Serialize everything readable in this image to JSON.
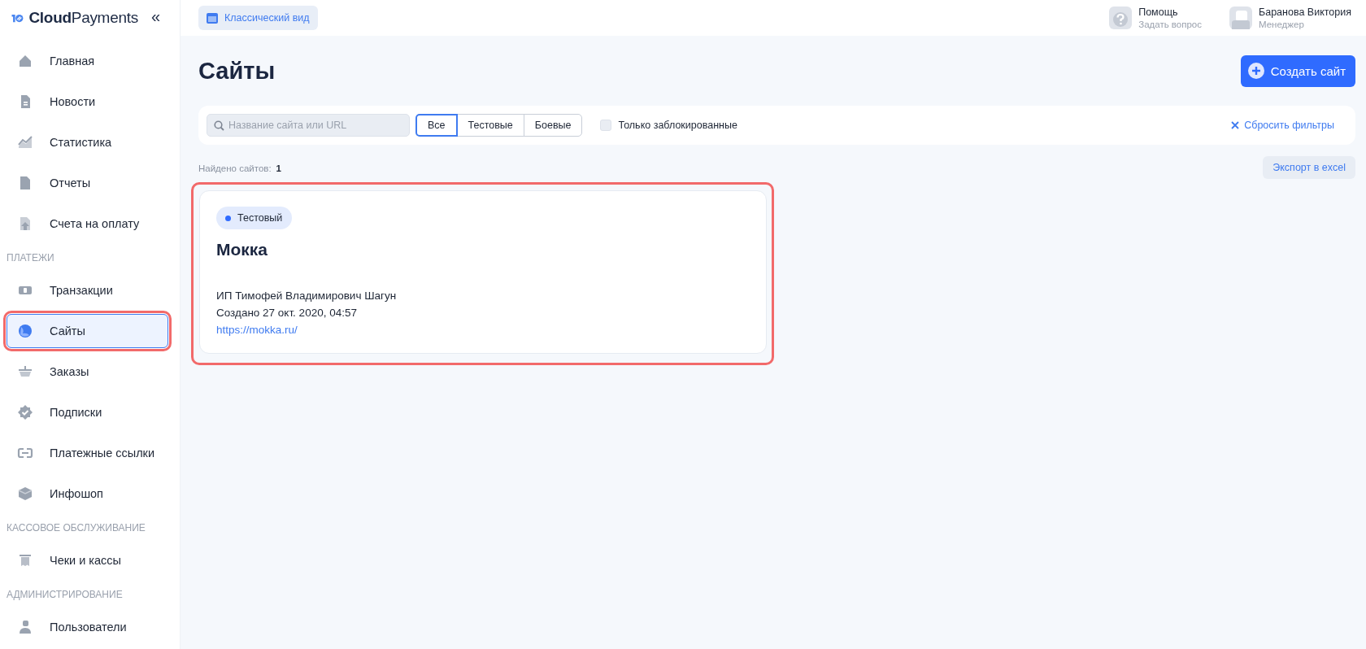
{
  "sidebar": {
    "logo": "**Cloud**Payments",
    "collapse": "«",
    "sections": [
      {
        "items": [
          {
            "label": "Главная",
            "kind": "home",
            "selected": false,
            "highlighted": false
          },
          {
            "label": "Новости",
            "kind": "doc",
            "selected": false,
            "highlighted": false
          },
          {
            "label": "Статистика",
            "kind": "chart",
            "selected": false,
            "highlighted": false
          },
          {
            "label": "Отчеты",
            "kind": "file",
            "selected": false,
            "highlighted": false
          },
          {
            "label": "Счета на оплату",
            "kind": "upload",
            "selected": false,
            "highlighted": false
          }
        ]
      },
      {
        "heading": "ПЛАТЕЖИ",
        "items": [
          {
            "label": "Транзакции",
            "kind": "card",
            "selected": false,
            "highlighted": false
          },
          {
            "label": "Сайты",
            "kind": "globe",
            "selected": true,
            "highlighted": true
          },
          {
            "label": "Заказы",
            "kind": "basket",
            "selected": false,
            "highlighted": false
          },
          {
            "label": "Подписки",
            "kind": "badge",
            "selected": false,
            "highlighted": false
          },
          {
            "label": "Платежные ссылки",
            "kind": "link",
            "selected": false,
            "highlighted": false
          },
          {
            "label": "Инфошоп",
            "kind": "cube",
            "selected": false,
            "highlighted": false
          }
        ]
      },
      {
        "heading": "КАССОВОЕ ОБСЛУЖИВАНИЕ",
        "items": [
          {
            "label": "Чеки и кассы",
            "kind": "receipt",
            "selected": false,
            "highlighted": false
          }
        ]
      },
      {
        "heading": "АДМИНИСТРИРОВАНИЕ",
        "items": [
          {
            "label": "Пользователи",
            "kind": "user",
            "selected": false,
            "highlighted": false
          }
        ]
      }
    ]
  },
  "topbar": {
    "classic_view": "Классический вид",
    "help": {
      "title": "Помощь",
      "subtitle": "Задать вопрос"
    },
    "user": {
      "name": "Баранова Виктория",
      "role": "Менеджер"
    }
  },
  "page": {
    "title": "Сайты",
    "create_button": "Создать сайт",
    "filters": {
      "search": {
        "placeholder": "Название сайта или URL"
      },
      "segments": [
        {
          "label": "Все",
          "selected": true
        },
        {
          "label": "Тестовые",
          "selected": false
        },
        {
          "label": "Боевые",
          "selected": false
        }
      ],
      "blocked_only": {
        "label": "Только заблокированные",
        "checked": false
      },
      "reset": "Сбросить фильтры"
    },
    "found": {
      "label": "Найдено сайтов:",
      "count": "1"
    },
    "export": "Экспорт в excel",
    "cards": [
      {
        "badge": {
          "label": "Тестовый",
          "color": "#2f6bff"
        },
        "name": "Мокка",
        "owner": "ИП Тимофей Владимирович Шагун",
        "created": "Создано 27 окт. 2020, 04:57",
        "url": "https://mokka.ru/",
        "highlighted": true
      }
    ]
  }
}
